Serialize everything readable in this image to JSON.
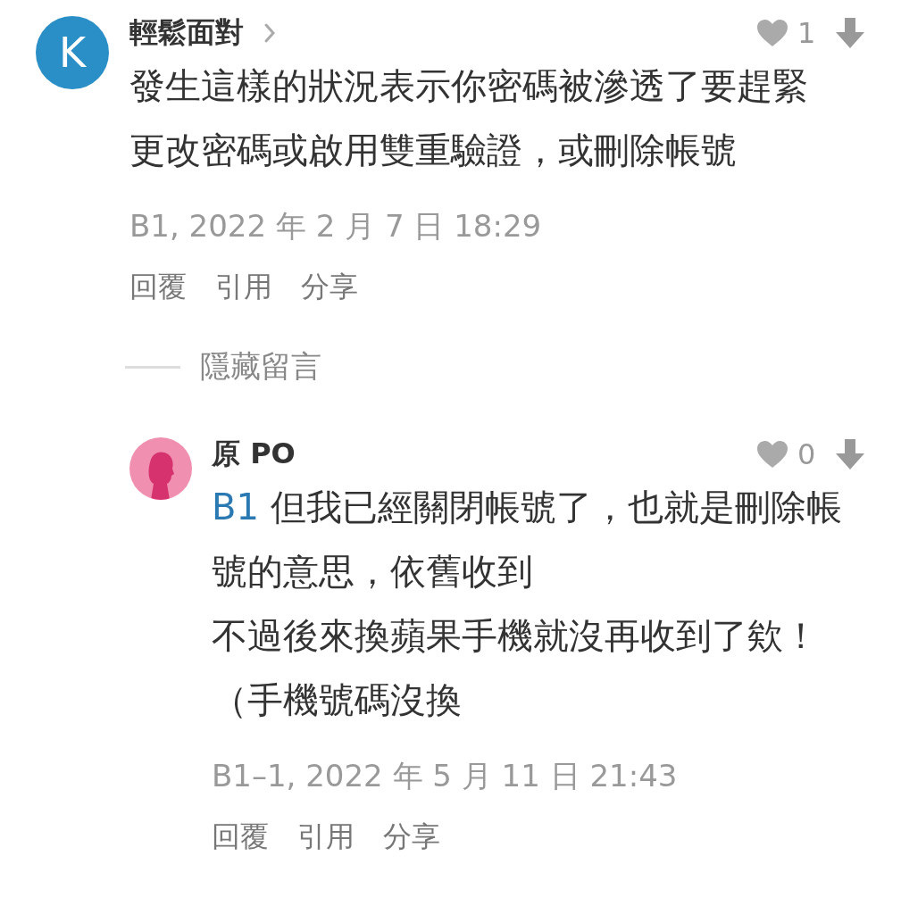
{
  "comments": [
    {
      "author": "輕鬆面對",
      "avatar": {
        "kind": "letter",
        "text": "K"
      },
      "show_chevron": true,
      "likes": "1",
      "paragraphs": [
        {
          "text": "發生這樣的狀況表示你密碼被滲透了要趕緊更改密碼或啟用雙重驗證，或刪除帳號"
        }
      ],
      "meta": "B1, 2022 年 2 月 7 日 18:29",
      "actions": [
        "回覆",
        "引用",
        "分享"
      ],
      "toggle": "隱藏留言",
      "replies": [
        {
          "author": "原 PO",
          "avatar": {
            "kind": "silhouette"
          },
          "show_chevron": false,
          "likes": "0",
          "paragraphs": [
            {
              "mention": "B1",
              "text": "但我已經關閉帳號了，也就是刪除帳號的意思，依舊收到"
            },
            {
              "text": "不過後來換蘋果手機就沒再收到了欸！"
            },
            {
              "text": "（手機號碼沒換"
            }
          ],
          "meta": "B1–1, 2022 年 5 月 11 日 21:43",
          "actions": [
            "回覆",
            "引用",
            "分享"
          ]
        }
      ]
    }
  ]
}
